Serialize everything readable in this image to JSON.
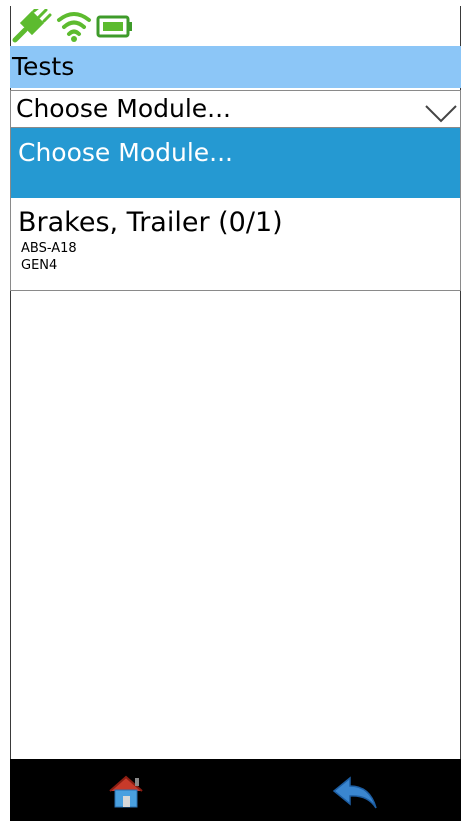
{
  "status_bar": {
    "icons": [
      "power-plug-icon",
      "wifi-icon",
      "battery-icon"
    ],
    "accent_color": "#5dbb2f"
  },
  "header": {
    "title": "Tests",
    "color": "#8cc6f7"
  },
  "module_select": {
    "selected_value": "Choose Module...",
    "options": [
      {
        "label": "Choose Module..."
      },
      {
        "label": "Brakes, Trailer (0/1)",
        "lines": [
          "ABS-A18",
          "GEN4"
        ]
      }
    ],
    "highlight_color": "#2599d2"
  },
  "bottom_bar": {
    "icons": [
      "home-icon",
      "back-arrow-icon"
    ]
  }
}
